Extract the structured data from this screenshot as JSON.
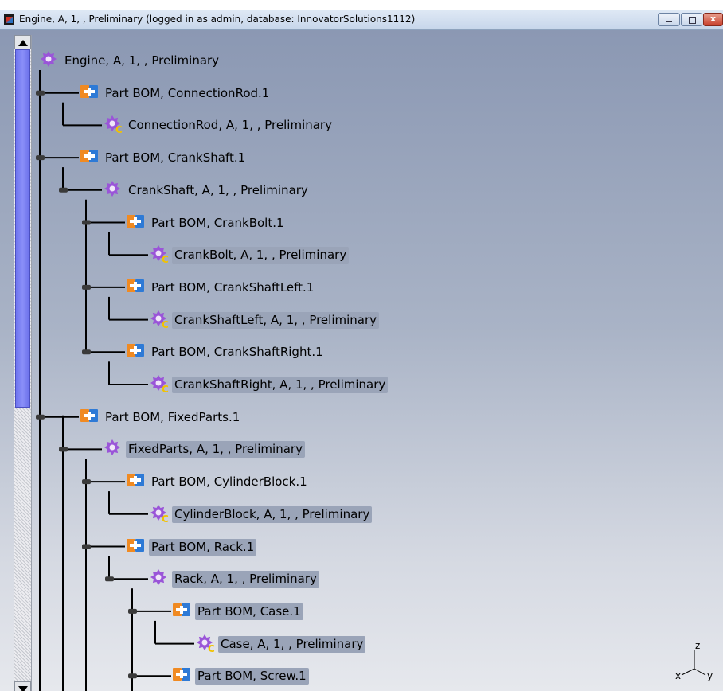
{
  "window": {
    "title": "Engine, A, 1, , Preliminary (logged in as admin, database: InnovatorSolutions1112)",
    "close_glyph": "x"
  },
  "scrollbar": {
    "position_fraction": 0.0
  },
  "tree": [
    {
      "label": "Engine, A, 1, , Preliminary",
      "icon": "product-gear-icon",
      "depth": 0,
      "highlight": false
    },
    {
      "label": "Part BOM, ConnectionRod.1",
      "icon": "part-bom-icon",
      "depth": 1,
      "highlight": false
    },
    {
      "label": "ConnectionRod, A, 1, , Preliminary",
      "icon": "part-gear-c-icon",
      "depth": 2,
      "highlight": false
    },
    {
      "label": "Part BOM, CrankShaft.1",
      "icon": "part-bom-icon",
      "depth": 1,
      "highlight": false
    },
    {
      "label": "CrankShaft, A, 1, , Preliminary",
      "icon": "product-gear-icon",
      "depth": 2,
      "highlight": false
    },
    {
      "label": "Part BOM, CrankBolt.1",
      "icon": "part-bom-icon",
      "depth": 3,
      "highlight": false
    },
    {
      "label": "CrankBolt, A, 1, , Preliminary",
      "icon": "part-gear-c-icon",
      "depth": 4,
      "highlight": true
    },
    {
      "label": "Part BOM, CrankShaftLeft.1",
      "icon": "part-bom-icon",
      "depth": 3,
      "highlight": false
    },
    {
      "label": "CrankShaftLeft, A, 1, , Preliminary",
      "icon": "part-gear-c-icon",
      "depth": 4,
      "highlight": true
    },
    {
      "label": "Part BOM, CrankShaftRight.1",
      "icon": "part-bom-icon",
      "depth": 3,
      "highlight": false
    },
    {
      "label": "CrankShaftRight, A, 1, , Preliminary",
      "icon": "part-gear-c-icon",
      "depth": 4,
      "highlight": true
    },
    {
      "label": "Part BOM, FixedParts.1",
      "icon": "part-bom-icon",
      "depth": 1,
      "highlight": false
    },
    {
      "label": "FixedParts, A, 1, , Preliminary",
      "icon": "product-gear-icon",
      "depth": 2,
      "highlight": true
    },
    {
      "label": "Part BOM, CylinderBlock.1",
      "icon": "part-bom-icon",
      "depth": 3,
      "highlight": false
    },
    {
      "label": "CylinderBlock, A, 1, , Preliminary",
      "icon": "part-gear-c-icon",
      "depth": 4,
      "highlight": true
    },
    {
      "label": "Part BOM, Rack.1",
      "icon": "part-bom-icon",
      "depth": 3,
      "highlight": true
    },
    {
      "label": "Rack, A, 1, , Preliminary",
      "icon": "product-gear-icon",
      "depth": 4,
      "highlight": true
    },
    {
      "label": "Part BOM, Case.1",
      "icon": "part-bom-icon",
      "depth": 5,
      "highlight": true
    },
    {
      "label": "Case, A, 1, , Preliminary",
      "icon": "part-gear-c-icon",
      "depth": 6,
      "highlight": true
    },
    {
      "label": "Part BOM, Screw.1",
      "icon": "part-bom-icon",
      "depth": 5,
      "highlight": true
    }
  ],
  "axis": {
    "x": "x",
    "y": "y",
    "z": "z"
  },
  "colors": {
    "gear": "#9a55d8",
    "bom_orange": "#f08a22",
    "bom_blue": "#2e7ad6",
    "c_badge": "#f2c200",
    "highlight": "#9aa4b8"
  }
}
